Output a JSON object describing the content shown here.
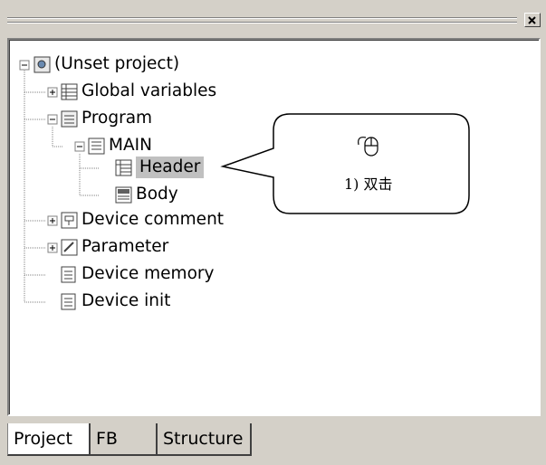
{
  "window": {
    "close_glyph": "×"
  },
  "tree": {
    "items": [
      {
        "label": "(Unset project)",
        "icon": "project-icon"
      },
      {
        "label": "Global variables",
        "icon": "table-icon"
      },
      {
        "label": "Program",
        "icon": "program-icon"
      },
      {
        "label": "MAIN",
        "icon": "document-icon"
      },
      {
        "label": "Header",
        "icon": "header-icon",
        "selected": true
      },
      {
        "label": "Body",
        "icon": "body-icon"
      },
      {
        "label": "Device comment",
        "icon": "device-comment-icon"
      },
      {
        "label": "Parameter",
        "icon": "parameter-icon"
      },
      {
        "label": "Device memory",
        "icon": "device-memory-icon"
      },
      {
        "label": "Device init",
        "icon": "device-init-icon"
      }
    ]
  },
  "callout": {
    "text": "1) 双击",
    "icon": "mouse-double-click-icon"
  },
  "tabs": [
    {
      "label": "Project",
      "active": true
    },
    {
      "label": "FB",
      "active": false
    },
    {
      "label": "Structure",
      "active": false
    }
  ]
}
